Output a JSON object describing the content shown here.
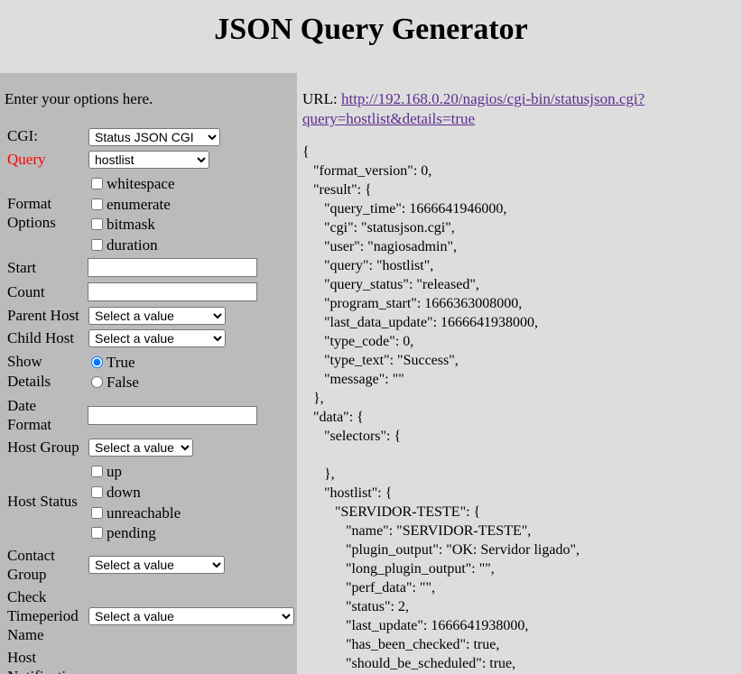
{
  "title": "JSON Query Generator",
  "form": {
    "intro": "Enter your options here.",
    "cgi_label": "CGI:",
    "cgi_value": "Status JSON CGI",
    "query_label": "Query",
    "query_value": "hostlist",
    "format_label_line1": "Format",
    "format_label_line2": "Options",
    "format_options": [
      "whitespace",
      "enumerate",
      "bitmask",
      "duration"
    ],
    "start_label": "Start",
    "count_label": "Count",
    "parent_host_label": "Parent Host",
    "parent_host_value": "Select a value",
    "child_host_label": "Child Host",
    "child_host_value": "Select a value",
    "show_details_line1": "Show",
    "show_details_line2": "Details",
    "show_details_true": "True",
    "show_details_false": "False",
    "date_format_line1": "Date",
    "date_format_line2": "Format",
    "host_group_label": "Host Group",
    "host_group_value": "Select a value",
    "host_status_label": "Host Status",
    "host_status_options": [
      "up",
      "down",
      "unreachable",
      "pending"
    ],
    "contact_group_line1": "Contact",
    "contact_group_line2": "Group",
    "contact_group_value": "Select a value",
    "check_timeperiod_line1": "Check",
    "check_timeperiod_line2": "Timeperiod",
    "check_timeperiod_line3": "Name",
    "check_timeperiod_value": "Select a value",
    "host_notif_line1": "Host",
    "host_notif_line2": "Notification"
  },
  "output": {
    "url_label": "URL:",
    "url": "http://192.168.0.20/nagios/cgi-bin/statusjson.cgi?query=hostlist&details=true",
    "json_lines": [
      "{",
      "   \"format_version\": 0,",
      "   \"result\": {",
      "      \"query_time\": 1666641946000,",
      "      \"cgi\": \"statusjson.cgi\",",
      "      \"user\": \"nagiosadmin\",",
      "      \"query\": \"hostlist\",",
      "      \"query_status\": \"released\",",
      "      \"program_start\": 1666363008000,",
      "      \"last_data_update\": 1666641938000,",
      "      \"type_code\": 0,",
      "      \"type_text\": \"Success\",",
      "      \"message\": \"\"",
      "   },",
      "   \"data\": {",
      "      \"selectors\": {",
      "",
      "      },",
      "      \"hostlist\": {",
      "         \"SERVIDOR-TESTE\": {",
      "            \"name\": \"SERVIDOR-TESTE\",",
      "            \"plugin_output\": \"OK: Servidor ligado\",",
      "            \"long_plugin_output\": \"\",",
      "            \"perf_data\": \"\",",
      "            \"status\": 2,",
      "            \"last_update\": 1666641938000,",
      "            \"has_been_checked\": true,",
      "            \"should_be_scheduled\": true,"
    ]
  }
}
